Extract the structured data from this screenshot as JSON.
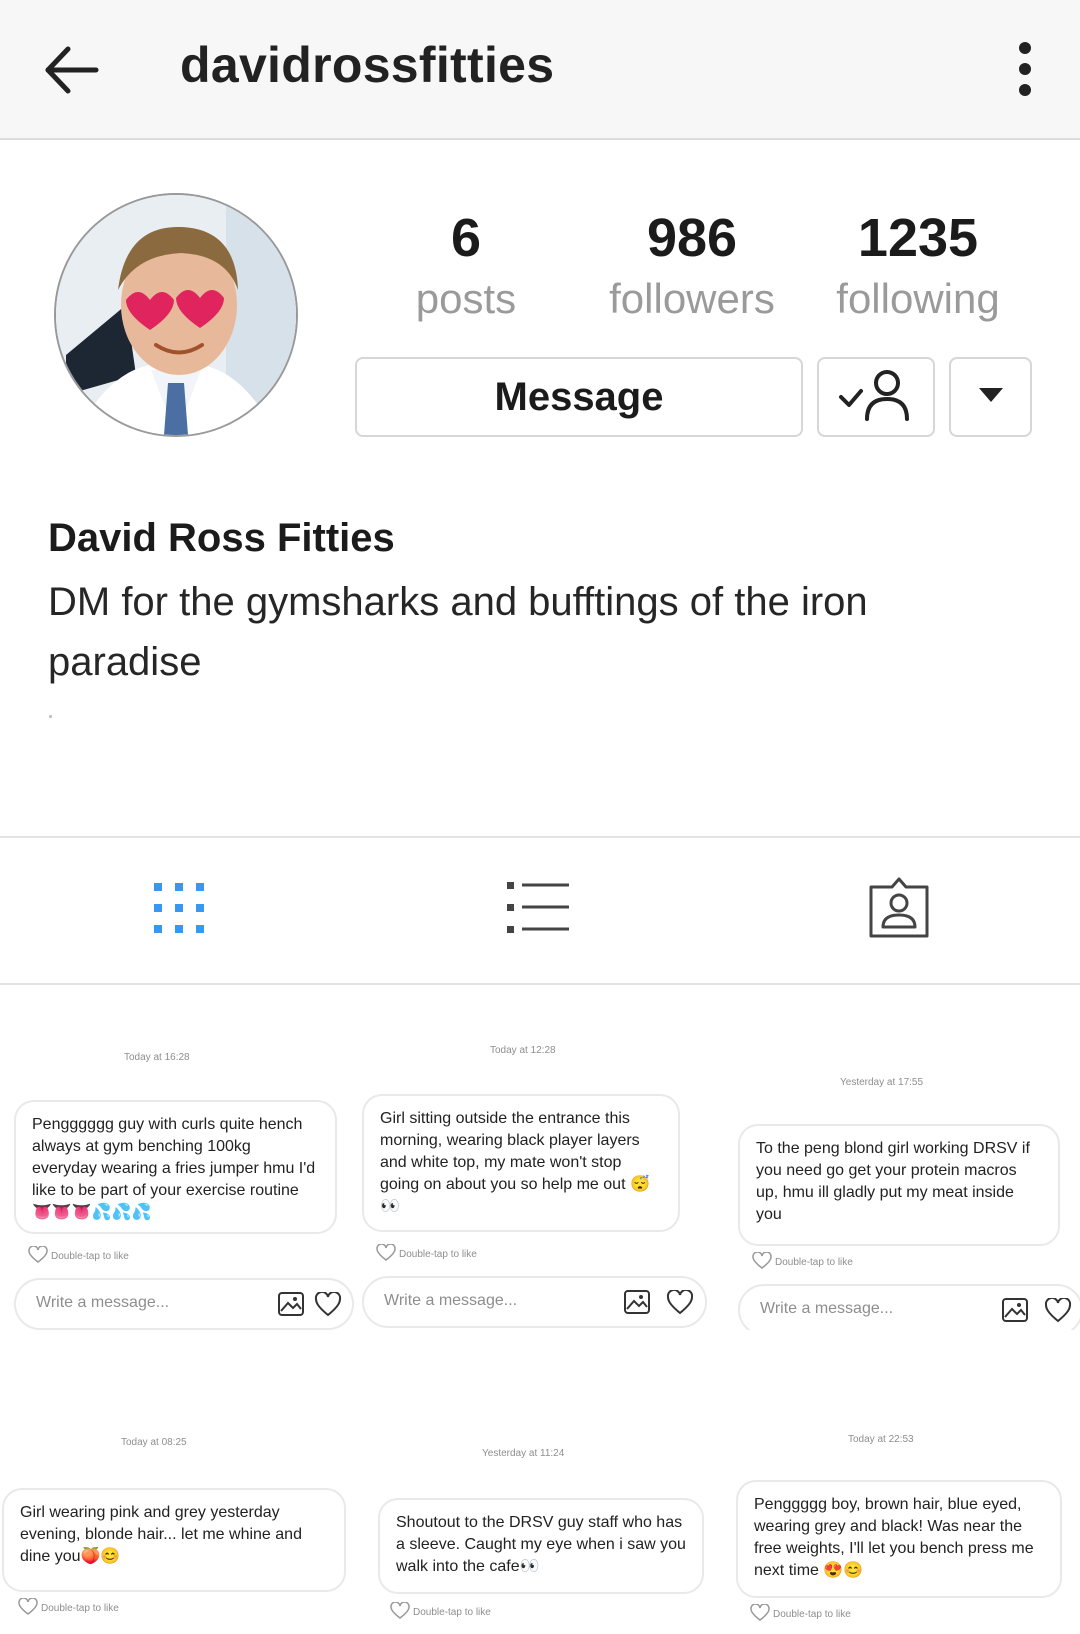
{
  "header": {
    "username": "davidrossfitties",
    "back_icon": "arrow-left-icon",
    "more_icon": "more-vertical-icon"
  },
  "profile": {
    "stats": [
      {
        "value": "6",
        "label": "posts"
      },
      {
        "value": "986",
        "label": "followers"
      },
      {
        "value": "1235",
        "label": "following"
      }
    ],
    "message_label": "Message",
    "following_icon": "person-check-icon",
    "dropdown_icon": "caret-down-icon",
    "display_name": "David Ross Fitties",
    "bio": "DM for the gymsharks and bufftings of the iron paradise"
  },
  "tabs": [
    {
      "icon": "grid-icon",
      "active": true
    },
    {
      "icon": "list-icon",
      "active": false
    },
    {
      "icon": "tagged-icon",
      "active": false
    }
  ],
  "colors": {
    "accent": "#3897f0",
    "heart": "#e0245e"
  },
  "posts": [
    {
      "timestamp": "Today at 16:28",
      "message": "Pengggggg guy with curls quite hench always at gym benching 100kg everyday wearing a fries jumper hmu I'd like to be part of your exercise routine 👅👅👅💦💦💦",
      "like_hint": "Double-tap to like",
      "placeholder": "Write a message..."
    },
    {
      "timestamp": "Today at 12:28",
      "message": "Girl sitting outside the entrance this morning, wearing black player layers and white top, my mate won't stop going on about you so help me out 😴👀",
      "like_hint": "Double-tap to like",
      "placeholder": "Write a message..."
    },
    {
      "timestamp": "Yesterday at 17:55",
      "message": "To the peng blond girl working DRSV if you need go get your protein macros up, hmu ill gladly put my meat inside you",
      "like_hint": "Double-tap to like",
      "placeholder": "Write a message..."
    },
    {
      "timestamp": "Today at 08:25",
      "message": "Girl wearing pink and grey yesterday evening, blonde hair... let me whine and dine you🍑😊",
      "like_hint": "Double-tap to like",
      "placeholder": ""
    },
    {
      "timestamp": "Yesterday at 11:24",
      "message": "Shoutout to the DRSV guy staff who has a sleeve. Caught my eye when i saw you walk into the cafe👀",
      "like_hint": "Double-tap to like",
      "placeholder": ""
    },
    {
      "timestamp": "Today at 22:53",
      "message": "Penggggg boy, brown hair, blue eyed, wearing grey and black! Was near the free weights, I'll let you bench press me next time 😍😊",
      "like_hint": "Double-tap to like",
      "placeholder": ""
    }
  ]
}
